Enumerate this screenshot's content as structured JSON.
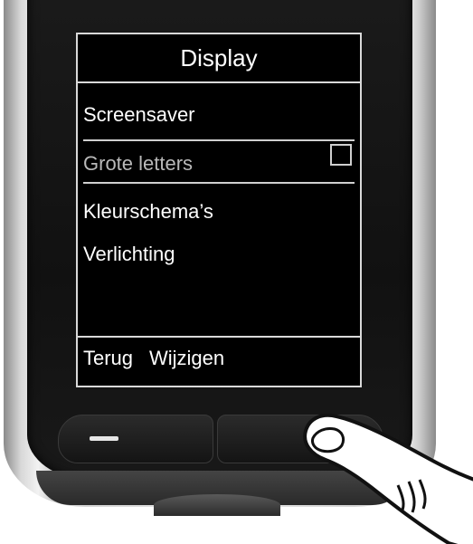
{
  "screen": {
    "title": "Display",
    "menu_items": [
      {
        "label": "Screensaver"
      },
      {
        "label": "Grote letters"
      },
      {
        "label": "Kleurschema’s"
      },
      {
        "label": "Verlichting"
      }
    ],
    "softkeys": {
      "left": "Terug",
      "right": "Wijzigen"
    },
    "grote_letters_checked": false
  },
  "icons": [
    "dash-icon",
    "checkbox-icon",
    "finger-pointer-icon"
  ]
}
